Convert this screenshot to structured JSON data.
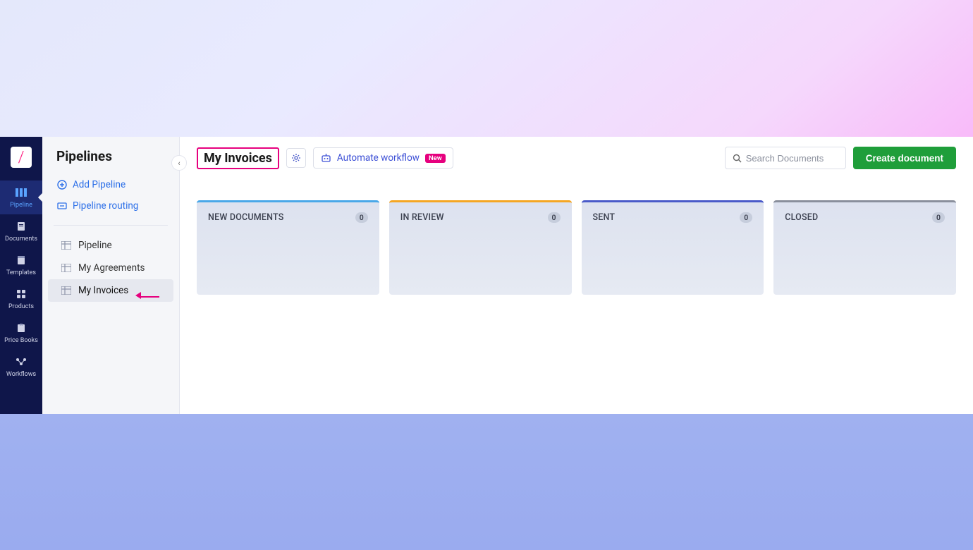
{
  "nav": {
    "items": [
      {
        "label": "Pipeline"
      },
      {
        "label": "Documents"
      },
      {
        "label": "Templates"
      },
      {
        "label": "Products"
      },
      {
        "label": "Price Books"
      },
      {
        "label": "Workflows"
      }
    ]
  },
  "sidebar": {
    "title": "Pipelines",
    "add_label": "Add Pipeline",
    "routing_label": "Pipeline routing",
    "items": [
      {
        "label": "Pipeline"
      },
      {
        "label": "My Agreements"
      },
      {
        "label": "My Invoices"
      }
    ]
  },
  "toolbar": {
    "page_title": "My Invoices",
    "automate_label": "Automate workflow",
    "automate_badge": "New",
    "search_placeholder": "Search Documents",
    "create_label": "Create document"
  },
  "board": {
    "columns": [
      {
        "title": "NEW DOCUMENTS",
        "count": "0",
        "accent": "#4aa8e8"
      },
      {
        "title": "IN REVIEW",
        "count": "0",
        "accent": "#f5a623"
      },
      {
        "title": "SENT",
        "count": "0",
        "accent": "#4a5ac9"
      },
      {
        "title": "CLOSED",
        "count": "0",
        "accent": "#8a8f9c"
      }
    ]
  }
}
